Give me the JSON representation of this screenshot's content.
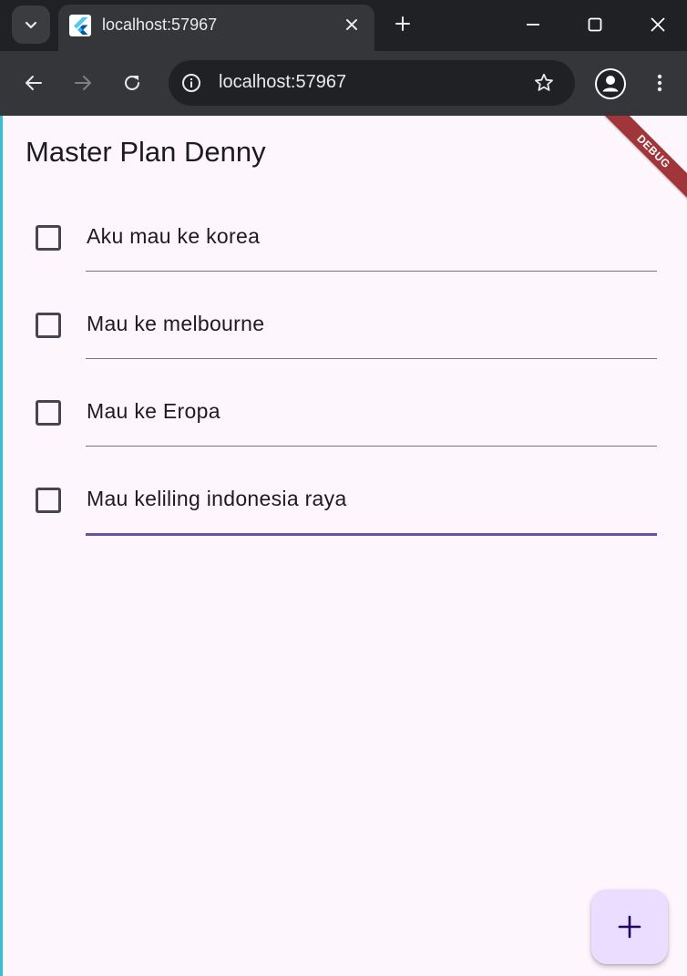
{
  "browser": {
    "tab_title": "localhost:57967",
    "url": "localhost:57967"
  },
  "app": {
    "title": "Master Plan Denny",
    "debug_banner": "DEBUG",
    "tasks": [
      {
        "description": "Aku mau ke korea",
        "complete": false
      },
      {
        "description": "Mau ke melbourne",
        "complete": false
      },
      {
        "description": "Mau ke Eropa",
        "complete": false
      },
      {
        "description": "Mau keliling indonesia raya",
        "complete": false
      }
    ],
    "focused_task_index": 3,
    "accent_color": "#6750a4",
    "background_color": "#fdf7fd",
    "fab_color": "#eaddff",
    "fab_icon": "add-icon"
  }
}
